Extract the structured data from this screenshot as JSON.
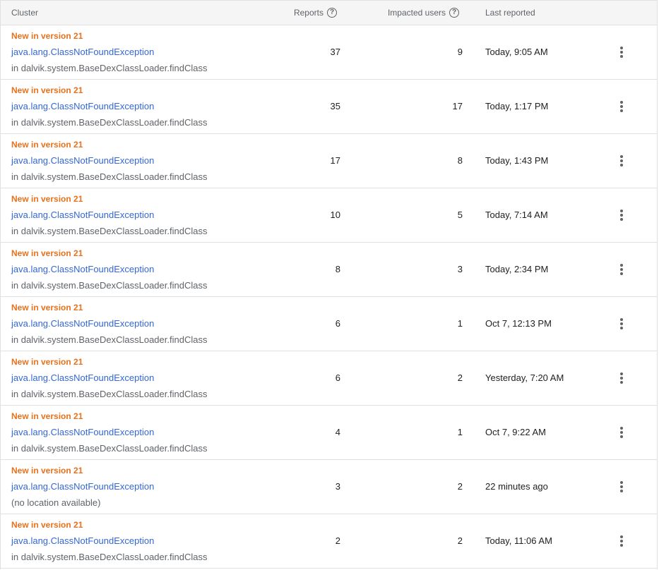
{
  "header": {
    "cluster": "Cluster",
    "reports": "Reports",
    "impacted_users": "Impacted users",
    "last_reported": "Last reported",
    "help_glyph": "?"
  },
  "rows": [
    {
      "badge": "New in version 21",
      "title": "java.lang.ClassNotFoundException",
      "location": "in dalvik.system.BaseDexClassLoader.findClass",
      "reports": "37",
      "users": "9",
      "last": "Today, 9:05 AM"
    },
    {
      "badge": "New in version 21",
      "title": "java.lang.ClassNotFoundException",
      "location": "in dalvik.system.BaseDexClassLoader.findClass",
      "reports": "35",
      "users": "17",
      "last": "Today, 1:17 PM"
    },
    {
      "badge": "New in version 21",
      "title": "java.lang.ClassNotFoundException",
      "location": "in dalvik.system.BaseDexClassLoader.findClass",
      "reports": "17",
      "users": "8",
      "last": "Today, 1:43 PM"
    },
    {
      "badge": "New in version 21",
      "title": "java.lang.ClassNotFoundException",
      "location": "in dalvik.system.BaseDexClassLoader.findClass",
      "reports": "10",
      "users": "5",
      "last": "Today, 7:14 AM"
    },
    {
      "badge": "New in version 21",
      "title": "java.lang.ClassNotFoundException",
      "location": "in dalvik.system.BaseDexClassLoader.findClass",
      "reports": "8",
      "users": "3",
      "last": "Today, 2:34 PM"
    },
    {
      "badge": "New in version 21",
      "title": "java.lang.ClassNotFoundException",
      "location": "in dalvik.system.BaseDexClassLoader.findClass",
      "reports": "6",
      "users": "1",
      "last": "Oct 7, 12:13 PM"
    },
    {
      "badge": "New in version 21",
      "title": "java.lang.ClassNotFoundException",
      "location": "in dalvik.system.BaseDexClassLoader.findClass",
      "reports": "6",
      "users": "2",
      "last": "Yesterday, 7:20 AM"
    },
    {
      "badge": "New in version 21",
      "title": "java.lang.ClassNotFoundException",
      "location": "in dalvik.system.BaseDexClassLoader.findClass",
      "reports": "4",
      "users": "1",
      "last": "Oct 7, 9:22 AM"
    },
    {
      "badge": "New in version 21",
      "title": "java.lang.ClassNotFoundException",
      "location": "(no location available)",
      "reports": "3",
      "users": "2",
      "last": "22 minutes ago"
    },
    {
      "badge": "New in version 21",
      "title": "java.lang.ClassNotFoundException",
      "location": "in dalvik.system.BaseDexClassLoader.findClass",
      "reports": "2",
      "users": "2",
      "last": "Today, 11:06 AM"
    }
  ],
  "icons": {
    "help": "help-circle-icon",
    "menu": "more-vert-icon"
  },
  "colors": {
    "badge": "#e8711c",
    "link": "#3367d6",
    "secondary": "#5f6368",
    "header_bg": "#f5f5f5",
    "divider": "#e0e0e0"
  }
}
